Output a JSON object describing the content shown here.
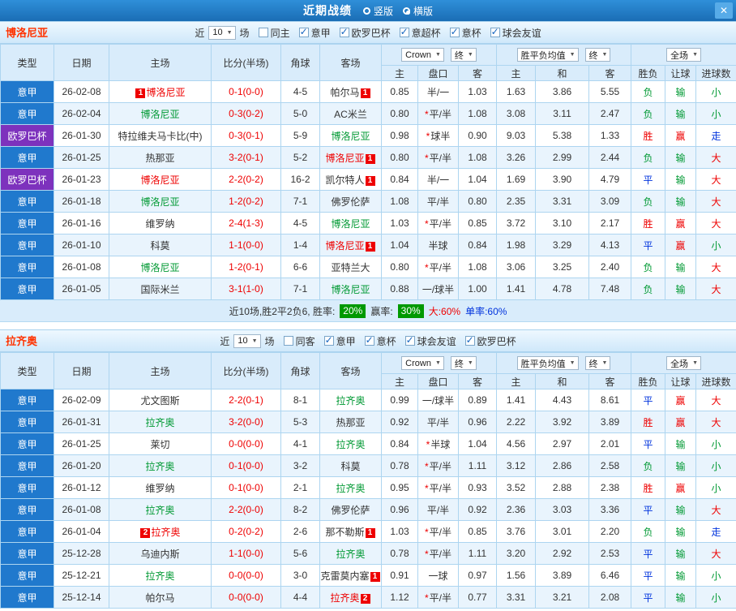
{
  "titlebar": {
    "title": "近期战绩",
    "views": [
      {
        "label": "竖版",
        "selected": false
      },
      {
        "label": "横版",
        "selected": true
      }
    ],
    "close_icon": "✕"
  },
  "table_headers": {
    "type": "类型",
    "date": "日期",
    "home": "主场",
    "score": "比分(半场)",
    "corner": "角球",
    "away": "客场",
    "ah_home": "主",
    "ah_plate": "盘口",
    "ah_away": "客",
    "eu_home": "主",
    "eu_draw": "和",
    "eu_away": "客",
    "result": "胜负",
    "handicap": "让球",
    "goals": "进球数",
    "bookmaker_select": "Crown",
    "final_select": "终",
    "avg_select": "胜平负均值",
    "scope_select": "全场"
  },
  "colors": {
    "accent_blue": "#2079cd",
    "accent_purple": "#7d32bd",
    "win_red": "#ee0000",
    "draw_blue": "#0033dd",
    "loss_green": "#009933",
    "chip_green": "#009900"
  },
  "sections": [
    {
      "team": "博洛尼亚",
      "near": "近",
      "count": "10",
      "unit": "场",
      "filters": [
        {
          "label": "同主",
          "checked": false
        },
        {
          "label": "意甲",
          "checked": true
        },
        {
          "label": "欧罗巴杯",
          "checked": true
        },
        {
          "label": "意超杯",
          "checked": true
        },
        {
          "label": "意杯",
          "checked": true
        },
        {
          "label": "球会友谊",
          "checked": true
        }
      ],
      "rows": [
        {
          "league": "意甲",
          "league_color": "blue",
          "date": "26-02-08",
          "home": {
            "name": "博洛尼亚",
            "color": "red",
            "badge": "1",
            "badge_pos": "pre"
          },
          "score": "0-1(0-0)",
          "corner": "4-5",
          "away": {
            "name": "帕尔马",
            "color": "black",
            "badge": "1",
            "badge_pos": "post"
          },
          "ah_home": "0.85",
          "plate": "半/一",
          "star": false,
          "ah_away": "1.03",
          "eu_home": "1.63",
          "eu_draw": "3.86",
          "eu_away": "5.55",
          "res": "负",
          "hres": "输",
          "gres": "小"
        },
        {
          "league": "意甲",
          "league_color": "blue",
          "date": "26-02-04",
          "home": {
            "name": "博洛尼亚",
            "color": "green"
          },
          "score": "0-3(0-2)",
          "corner": "5-0",
          "away": {
            "name": "AC米兰",
            "color": "black"
          },
          "ah_home": "0.80",
          "plate": "平/半",
          "star": true,
          "ah_away": "1.08",
          "eu_home": "3.08",
          "eu_draw": "3.11",
          "eu_away": "2.47",
          "res": "负",
          "hres": "输",
          "gres": "小"
        },
        {
          "league": "欧罗巴杯",
          "league_color": "purple",
          "date": "26-01-30",
          "home": {
            "name": "特拉维夫马卡比(中)",
            "color": "black"
          },
          "score": "0-3(0-1)",
          "corner": "5-9",
          "away": {
            "name": "博洛尼亚",
            "color": "green"
          },
          "ah_home": "0.98",
          "plate": "球半",
          "star": true,
          "ah_away": "0.90",
          "eu_home": "9.03",
          "eu_draw": "5.38",
          "eu_away": "1.33",
          "res": "胜",
          "hres": "赢",
          "gres": "走"
        },
        {
          "league": "意甲",
          "league_color": "blue",
          "date": "26-01-25",
          "home": {
            "name": "热那亚",
            "color": "black"
          },
          "score": "3-2(0-1)",
          "corner": "5-2",
          "away": {
            "name": "博洛尼亚",
            "color": "red",
            "badge": "1",
            "badge_pos": "post"
          },
          "ah_home": "0.80",
          "plate": "平/半",
          "star": true,
          "ah_away": "1.08",
          "eu_home": "3.26",
          "eu_draw": "2.99",
          "eu_away": "2.44",
          "res": "负",
          "hres": "输",
          "gres": "大"
        },
        {
          "league": "欧罗巴杯",
          "league_color": "purple",
          "date": "26-01-23",
          "home": {
            "name": "博洛尼亚",
            "color": "red"
          },
          "score": "2-2(0-2)",
          "corner": "16-2",
          "away": {
            "name": "凯尔特人",
            "color": "black",
            "badge": "1",
            "badge_pos": "post"
          },
          "ah_home": "0.84",
          "plate": "半/一",
          "star": false,
          "ah_away": "1.04",
          "eu_home": "1.69",
          "eu_draw": "3.90",
          "eu_away": "4.79",
          "res": "平",
          "hres": "输",
          "gres": "大"
        },
        {
          "league": "意甲",
          "league_color": "blue",
          "date": "26-01-18",
          "home": {
            "name": "博洛尼亚",
            "color": "green"
          },
          "score": "1-2(0-2)",
          "corner": "7-1",
          "away": {
            "name": "佛罗伦萨",
            "color": "black"
          },
          "ah_home": "1.08",
          "plate": "平/半",
          "star": false,
          "ah_away": "0.80",
          "eu_home": "2.35",
          "eu_draw": "3.31",
          "eu_away": "3.09",
          "res": "负",
          "hres": "输",
          "gres": "大"
        },
        {
          "league": "意甲",
          "league_color": "blue",
          "date": "26-01-16",
          "home": {
            "name": "维罗纳",
            "color": "black"
          },
          "score": "2-4(1-3)",
          "corner": "4-5",
          "away": {
            "name": "博洛尼亚",
            "color": "green"
          },
          "ah_home": "1.03",
          "plate": "平/半",
          "star": true,
          "ah_away": "0.85",
          "eu_home": "3.72",
          "eu_draw": "3.10",
          "eu_away": "2.17",
          "res": "胜",
          "hres": "赢",
          "gres": "大"
        },
        {
          "league": "意甲",
          "league_color": "blue",
          "date": "26-01-10",
          "home": {
            "name": "科莫",
            "color": "black"
          },
          "score": "1-1(0-0)",
          "corner": "1-4",
          "away": {
            "name": "博洛尼亚",
            "color": "red",
            "badge": "1",
            "badge_pos": "post"
          },
          "ah_home": "1.04",
          "plate": "半球",
          "star": false,
          "ah_away": "0.84",
          "eu_home": "1.98",
          "eu_draw": "3.29",
          "eu_away": "4.13",
          "res": "平",
          "hres": "赢",
          "gres": "小"
        },
        {
          "league": "意甲",
          "league_color": "blue",
          "date": "26-01-08",
          "home": {
            "name": "博洛尼亚",
            "color": "green"
          },
          "score": "1-2(0-1)",
          "corner": "6-6",
          "away": {
            "name": "亚特兰大",
            "color": "black"
          },
          "ah_home": "0.80",
          "plate": "平/半",
          "star": true,
          "ah_away": "1.08",
          "eu_home": "3.06",
          "eu_draw": "3.25",
          "eu_away": "2.40",
          "res": "负",
          "hres": "输",
          "gres": "大"
        },
        {
          "league": "意甲",
          "league_color": "blue",
          "date": "26-01-05",
          "home": {
            "name": "国际米兰",
            "color": "black"
          },
          "score": "3-1(1-0)",
          "corner": "7-1",
          "away": {
            "name": "博洛尼亚",
            "color": "green"
          },
          "ah_home": "0.88",
          "plate": "一/球半",
          "star": false,
          "ah_away": "1.00",
          "eu_home": "1.41",
          "eu_draw": "4.78",
          "eu_away": "7.48",
          "res": "负",
          "hres": "输",
          "gres": "大"
        }
      ],
      "summary": {
        "prefix": "近10场,胜2平2负6, 胜率:",
        "win_rate": "20%",
        "mid": "赢率:",
        "cover_rate": "30%",
        "big": "大:60%",
        "odd": "单率:60%"
      }
    },
    {
      "team": "拉齐奥",
      "near": "近",
      "count": "10",
      "unit": "场",
      "filters": [
        {
          "label": "同客",
          "checked": false
        },
        {
          "label": "意甲",
          "checked": true
        },
        {
          "label": "意杯",
          "checked": true
        },
        {
          "label": "球会友谊",
          "checked": true
        },
        {
          "label": "欧罗巴杯",
          "checked": true
        }
      ],
      "rows": [
        {
          "league": "意甲",
          "league_color": "blue",
          "date": "26-02-09",
          "home": {
            "name": "尤文图斯",
            "color": "black"
          },
          "score": "2-2(0-1)",
          "corner": "8-1",
          "away": {
            "name": "拉齐奥",
            "color": "green"
          },
          "ah_home": "0.99",
          "plate": "一/球半",
          "star": false,
          "ah_away": "0.89",
          "eu_home": "1.41",
          "eu_draw": "4.43",
          "eu_away": "8.61",
          "res": "平",
          "hres": "赢",
          "gres": "大"
        },
        {
          "league": "意甲",
          "league_color": "blue",
          "date": "26-01-31",
          "home": {
            "name": "拉齐奥",
            "color": "green"
          },
          "score": "3-2(0-0)",
          "corner": "5-3",
          "away": {
            "name": "热那亚",
            "color": "black"
          },
          "ah_home": "0.92",
          "plate": "平/半",
          "star": false,
          "ah_away": "0.96",
          "eu_home": "2.22",
          "eu_draw": "3.92",
          "eu_away": "3.89",
          "res": "胜",
          "hres": "赢",
          "gres": "大"
        },
        {
          "league": "意甲",
          "league_color": "blue",
          "date": "26-01-25",
          "home": {
            "name": "莱切",
            "color": "black"
          },
          "score": "0-0(0-0)",
          "corner": "4-1",
          "away": {
            "name": "拉齐奥",
            "color": "green"
          },
          "ah_home": "0.84",
          "plate": "半球",
          "star": true,
          "ah_away": "1.04",
          "eu_home": "4.56",
          "eu_draw": "2.97",
          "eu_away": "2.01",
          "res": "平",
          "hres": "输",
          "gres": "小"
        },
        {
          "league": "意甲",
          "league_color": "blue",
          "date": "26-01-20",
          "home": {
            "name": "拉齐奥",
            "color": "green"
          },
          "score": "0-1(0-0)",
          "corner": "3-2",
          "away": {
            "name": "科莫",
            "color": "black"
          },
          "ah_home": "0.78",
          "plate": "平/半",
          "star": true,
          "ah_away": "1.11",
          "eu_home": "3.12",
          "eu_draw": "2.86",
          "eu_away": "2.58",
          "res": "负",
          "hres": "输",
          "gres": "小"
        },
        {
          "league": "意甲",
          "league_color": "blue",
          "date": "26-01-12",
          "home": {
            "name": "维罗纳",
            "color": "black"
          },
          "score": "0-1(0-0)",
          "corner": "2-1",
          "away": {
            "name": "拉齐奥",
            "color": "green"
          },
          "ah_home": "0.95",
          "plate": "平/半",
          "star": true,
          "ah_away": "0.93",
          "eu_home": "3.52",
          "eu_draw": "2.88",
          "eu_away": "2.38",
          "res": "胜",
          "hres": "赢",
          "gres": "小"
        },
        {
          "league": "意甲",
          "league_color": "blue",
          "date": "26-01-08",
          "home": {
            "name": "拉齐奥",
            "color": "green"
          },
          "score": "2-2(0-0)",
          "corner": "8-2",
          "away": {
            "name": "佛罗伦萨",
            "color": "black"
          },
          "ah_home": "0.96",
          "plate": "平/半",
          "star": false,
          "ah_away": "0.92",
          "eu_home": "2.36",
          "eu_draw": "3.03",
          "eu_away": "3.36",
          "res": "平",
          "hres": "输",
          "gres": "大"
        },
        {
          "league": "意甲",
          "league_color": "blue",
          "date": "26-01-04",
          "home": {
            "name": "拉齐奥",
            "color": "red",
            "badge": "2",
            "badge_pos": "pre"
          },
          "score": "0-2(0-2)",
          "corner": "2-6",
          "away": {
            "name": "那不勒斯",
            "color": "black",
            "badge": "1",
            "badge_pos": "post"
          },
          "ah_home": "1.03",
          "plate": "平/半",
          "star": true,
          "ah_away": "0.85",
          "eu_home": "3.76",
          "eu_draw": "3.01",
          "eu_away": "2.20",
          "res": "负",
          "hres": "输",
          "gres": "走"
        },
        {
          "league": "意甲",
          "league_color": "blue",
          "date": "25-12-28",
          "home": {
            "name": "乌迪内斯",
            "color": "black"
          },
          "score": "1-1(0-0)",
          "corner": "5-6",
          "away": {
            "name": "拉齐奥",
            "color": "green"
          },
          "ah_home": "0.78",
          "plate": "平/半",
          "star": true,
          "ah_away": "1.11",
          "eu_home": "3.20",
          "eu_draw": "2.92",
          "eu_away": "2.53",
          "res": "平",
          "hres": "输",
          "gres": "大"
        },
        {
          "league": "意甲",
          "league_color": "blue",
          "date": "25-12-21",
          "home": {
            "name": "拉齐奥",
            "color": "green"
          },
          "score": "0-0(0-0)",
          "corner": "3-0",
          "away": {
            "name": "克雷莫内塞",
            "color": "black",
            "badge": "1",
            "badge_pos": "post"
          },
          "ah_home": "0.91",
          "plate": "一球",
          "star": false,
          "ah_away": "0.97",
          "eu_home": "1.56",
          "eu_draw": "3.89",
          "eu_away": "6.46",
          "res": "平",
          "hres": "输",
          "gres": "小"
        },
        {
          "league": "意甲",
          "league_color": "blue",
          "date": "25-12-14",
          "home": {
            "name": "帕尔马",
            "color": "black"
          },
          "score": "0-0(0-0)",
          "corner": "4-4",
          "away": {
            "name": "拉齐奥",
            "color": "red",
            "badge": "2",
            "badge_pos": "post"
          },
          "ah_home": "1.12",
          "plate": "平/半",
          "star": true,
          "ah_away": "0.77",
          "eu_home": "3.31",
          "eu_draw": "3.21",
          "eu_away": "2.08",
          "res": "平",
          "hres": "输",
          "gres": "小"
        }
      ],
      "summary": null
    }
  ]
}
